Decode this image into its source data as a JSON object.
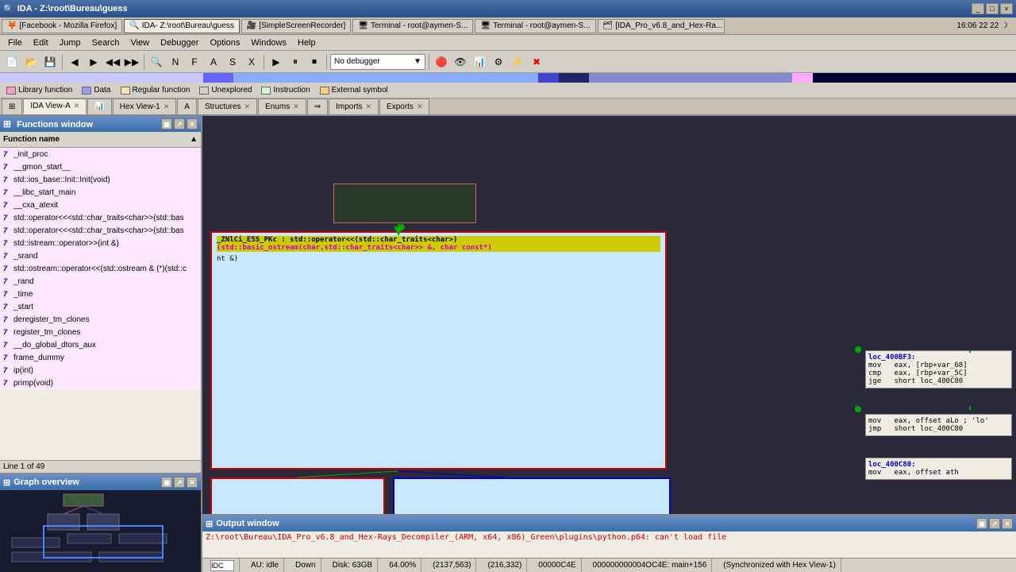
{
  "titlebar": {
    "title": "IDA - Z:\\root\\Bureau\\guess",
    "controls": [
      "_",
      "□",
      "×"
    ]
  },
  "taskbar": {
    "items": [
      {
        "label": "[Facebook - Mozilla Firefox]",
        "icon": "🦊",
        "active": false
      },
      {
        "label": "IDA- Z:\\root\\Bureau\\guess",
        "icon": "🔍",
        "active": true
      },
      {
        "label": "[SimpleScreenRecorder]",
        "icon": "🎥",
        "active": false
      },
      {
        "label": "Terminal - root@aymen-S...",
        "icon": "🖥",
        "active": false
      },
      {
        "label": "Terminal - root@aymen-S...",
        "icon": "🖥",
        "active": false
      },
      {
        "label": "[IDA_Pro_v6.8_and_Hex-Ra...",
        "icon": "🖿",
        "active": false
      }
    ],
    "clock": "16:06  22 22 ☽"
  },
  "menubar": {
    "items": [
      "File",
      "Edit",
      "Jump",
      "Search",
      "View",
      "Debugger",
      "Options",
      "Windows",
      "Help"
    ]
  },
  "legend": {
    "items": [
      {
        "label": "Library function",
        "color": "#ff99cc"
      },
      {
        "label": "Data",
        "color": "#9999ff"
      },
      {
        "label": "Regular function",
        "color": "#ffe0b0"
      },
      {
        "label": "Unexplored",
        "color": "#d4d0c8"
      },
      {
        "label": "Instruction",
        "color": "#c8ffcc"
      },
      {
        "label": "External symbol",
        "color": "#ffcc88"
      }
    ]
  },
  "tabs": {
    "functions_window": {
      "title": "Functions window",
      "active": false
    },
    "main_tabs": [
      {
        "label": "IDA View-A",
        "active": true,
        "closeable": true
      },
      {
        "label": "Hex View-1",
        "active": false,
        "closeable": true
      },
      {
        "label": "Structures",
        "active": false,
        "closeable": true
      },
      {
        "label": "Enums",
        "active": false,
        "closeable": true
      },
      {
        "label": "Imports",
        "active": false,
        "closeable": true
      },
      {
        "label": "Exports",
        "active": false,
        "closeable": true
      }
    ]
  },
  "functions_panel": {
    "title": "Functions window",
    "column_header": "Function name",
    "items": [
      "_init_proc",
      "__gmon_start__",
      "std::ios_base::Init::Init(void)",
      "__libc_start_main",
      "__cxa_atexit",
      "std::operator<<<std::char_traits<char>>(std::bas",
      "std::operator<<<std::char_traits<char>>(std::bas",
      "std::istream::operator>>(int &)",
      "_srand",
      "std::ostream::operator<<(std::ostream & (*)(std::c",
      "_rand",
      "_time",
      "_start",
      "deregister_tm_clones",
      "register_tm_clones",
      "__do_global_dtors_aux",
      "frame_dummy",
      "ip(int)",
      "primp(void)"
    ],
    "line_info": "Line 1 of 49"
  },
  "graph_overview": {
    "title": "Graph overview"
  },
  "ida_view": {
    "code_block": {
      "text": "_ZNlCi_E5S_PKc : std::operator<<(std::char_traits<char>)(std::basic_ostream(char,std::char_traits<char>> &, char const*)",
      "sub_text": "nt &)"
    }
  },
  "right_nodes": [
    {
      "id": "loc_400BF3",
      "lines": [
        "loc_400BF3:",
        "mov    eax, [rbp+var_68]",
        "cmp    eax, [rbp+var_5C]",
        "jge    short loc_400C80"
      ]
    },
    {
      "id": "loc_400C80_lower",
      "lines": [
        "mov    eax, offset aLo ; 'lo'",
        "jmp    short loc_400C80"
      ]
    },
    {
      "id": "loc_400C80_right",
      "lines": [
        "loc_400C80:",
        "mov    eax, offset ath"
      ]
    }
  ],
  "output_window": {
    "title": "Output window",
    "text": "Z:\\root\\Bureau\\IDA_Pro_v6.8_and_Hex-Rays_Decompiler_(ARM, x64, x86)_Green\\plugins\\python.p64: can't load file"
  },
  "statusbar": {
    "au": "AU: idle",
    "scroll": "Down",
    "disk": "Disk: 63GB",
    "zoom": "64.00%",
    "coords": "(2137,563)",
    "offset": "(216,332)",
    "address": "00000C4E",
    "segment": "000000000004OC4E: main+156",
    "sync": "(Synchronized with Hex View-1)"
  },
  "debugger_dropdown": {
    "value": "No debugger"
  },
  "idc_input": {
    "placeholder": "IDC"
  }
}
